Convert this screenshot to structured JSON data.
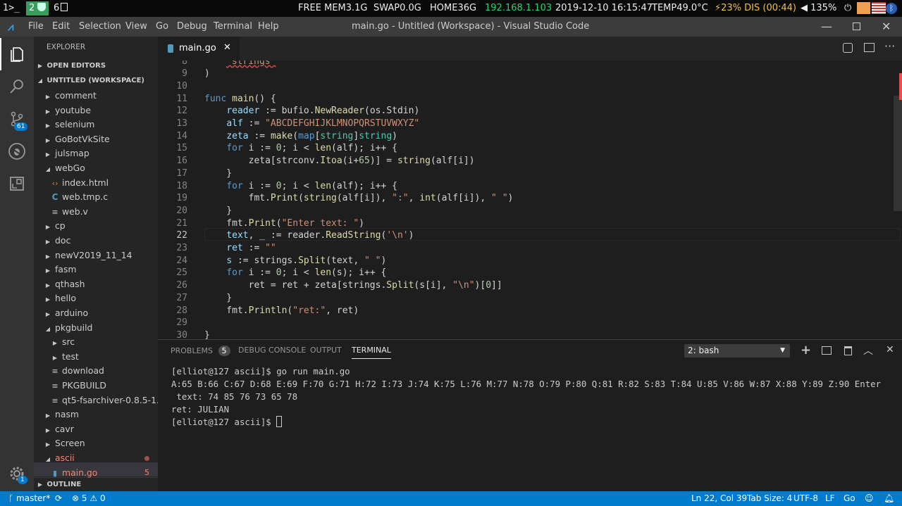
{
  "topbar": {
    "ws1": "1",
    "ws2": "2",
    "ws3": "6",
    "free_mem": "FREE MEM3.1G",
    "swap": "SWAP0.0G",
    "home": "HOME36G",
    "ip": "192.168.1.103",
    "datetime": "2019-12-10 16:15:47",
    "temp": "TEMP49.0°C",
    "battery": "⚡23% DIS (00:44)",
    "volume": "135%"
  },
  "titlebar": {
    "menus": [
      "File",
      "Edit",
      "Selection",
      "View",
      "Go",
      "Debug",
      "Terminal",
      "Help"
    ],
    "title": "main.go - Untitled (Workspace) - Visual Studio Code"
  },
  "activity": {
    "badge": "61",
    "settings_badge": "1"
  },
  "sidebar": {
    "header": "EXPLORER",
    "open_editors": "OPEN EDITORS",
    "workspace": "UNTITLED (WORKSPACE)",
    "items": [
      {
        "label": "comment",
        "indent": 1,
        "kind": "folder"
      },
      {
        "label": "youtube",
        "indent": 1,
        "kind": "folder"
      },
      {
        "label": "selenium",
        "indent": 1,
        "kind": "folder"
      },
      {
        "label": "GoBotVkSite",
        "indent": 1,
        "kind": "folder"
      },
      {
        "label": "julsmap",
        "indent": 1,
        "kind": "folder"
      },
      {
        "label": "webGo",
        "indent": 1,
        "kind": "folder-open"
      },
      {
        "label": "index.html",
        "indent": 2,
        "kind": "html"
      },
      {
        "label": "web.tmp.c",
        "indent": 2,
        "kind": "c"
      },
      {
        "label": "web.v",
        "indent": 2,
        "kind": "file"
      },
      {
        "label": "cp",
        "indent": 1,
        "kind": "folder"
      },
      {
        "label": "doc",
        "indent": 1,
        "kind": "folder"
      },
      {
        "label": "newV2019_11_14",
        "indent": 1,
        "kind": "folder"
      },
      {
        "label": "fasm",
        "indent": 1,
        "kind": "folder"
      },
      {
        "label": "qthash",
        "indent": 1,
        "kind": "folder"
      },
      {
        "label": "hello",
        "indent": 1,
        "kind": "folder"
      },
      {
        "label": "arduino",
        "indent": 1,
        "kind": "folder"
      },
      {
        "label": "pkgbuild",
        "indent": 1,
        "kind": "folder-open"
      },
      {
        "label": "src",
        "indent": 2,
        "kind": "folder"
      },
      {
        "label": "test",
        "indent": 2,
        "kind": "folder"
      },
      {
        "label": "download",
        "indent": 2,
        "kind": "file"
      },
      {
        "label": "PKGBUILD",
        "indent": 2,
        "kind": "file"
      },
      {
        "label": "qt5-fsarchiver-0.8.5-1....",
        "indent": 2,
        "kind": "file"
      },
      {
        "label": "nasm",
        "indent": 1,
        "kind": "folder"
      },
      {
        "label": "cavr",
        "indent": 1,
        "kind": "folder"
      },
      {
        "label": "Screen",
        "indent": 1,
        "kind": "folder"
      },
      {
        "label": "ascii",
        "indent": 1,
        "kind": "folder-open-err"
      },
      {
        "label": "main.go",
        "indent": 2,
        "kind": "go",
        "badge": "5"
      }
    ],
    "outline": "OUTLINE"
  },
  "editor": {
    "tab_label": "main.go",
    "lines": [
      {
        "n": "8",
        "c": [
          [
            "s",
            "\"strings\""
          ]
        ]
      },
      {
        "n": "9",
        "c": [
          [
            "p",
            ")"
          ]
        ]
      },
      {
        "n": "10",
        "c": []
      },
      {
        "n": "11",
        "c": [
          [
            "k",
            "func"
          ],
          [
            "p",
            " "
          ],
          [
            "f",
            "main"
          ],
          [
            "p",
            "() {"
          ]
        ]
      },
      {
        "n": "12",
        "c": [
          [
            "p",
            "    "
          ],
          [
            "v",
            "reader"
          ],
          [
            "p",
            " := bufio."
          ],
          [
            "f",
            "NewReader"
          ],
          [
            "p",
            "(os.Stdin)"
          ]
        ]
      },
      {
        "n": "13",
        "c": [
          [
            "p",
            "    "
          ],
          [
            "v",
            "alf"
          ],
          [
            "p",
            " := "
          ],
          [
            "s",
            "\"ABCDEFGHIJKLMNOPQRSTUVWXYZ\""
          ]
        ]
      },
      {
        "n": "14",
        "c": [
          [
            "p",
            "    "
          ],
          [
            "v",
            "zeta"
          ],
          [
            "p",
            " := "
          ],
          [
            "f",
            "make"
          ],
          [
            "p",
            "("
          ],
          [
            "k",
            "map"
          ],
          [
            "p",
            "["
          ],
          [
            "t",
            "string"
          ],
          [
            "p",
            "]"
          ],
          [
            "t",
            "string"
          ],
          [
            "p",
            ")"
          ]
        ]
      },
      {
        "n": "15",
        "c": [
          [
            "p",
            "    "
          ],
          [
            "k",
            "for"
          ],
          [
            "p",
            " i := "
          ],
          [
            "n",
            "0"
          ],
          [
            "p",
            "; i < "
          ],
          [
            "f",
            "len"
          ],
          [
            "p",
            "(alf); i++ {"
          ]
        ]
      },
      {
        "n": "16",
        "c": [
          [
            "p",
            "        zeta[strconv."
          ],
          [
            "f",
            "Itoa"
          ],
          [
            "p",
            "(i+"
          ],
          [
            "n",
            "65"
          ],
          [
            "p",
            ")] = "
          ],
          [
            "f",
            "string"
          ],
          [
            "p",
            "(alf[i])"
          ]
        ]
      },
      {
        "n": "17",
        "c": [
          [
            "p",
            "    }"
          ]
        ]
      },
      {
        "n": "18",
        "c": [
          [
            "p",
            "    "
          ],
          [
            "k",
            "for"
          ],
          [
            "p",
            " i := "
          ],
          [
            "n",
            "0"
          ],
          [
            "p",
            "; i < "
          ],
          [
            "f",
            "len"
          ],
          [
            "p",
            "(alf); i++ {"
          ]
        ]
      },
      {
        "n": "19",
        "c": [
          [
            "p",
            "        fmt."
          ],
          [
            "f",
            "Print"
          ],
          [
            "p",
            "("
          ],
          [
            "f",
            "string"
          ],
          [
            "p",
            "(alf[i]), "
          ],
          [
            "s",
            "\":\""
          ],
          [
            "p",
            ", "
          ],
          [
            "f",
            "int"
          ],
          [
            "p",
            "(alf[i]), "
          ],
          [
            "s",
            "\" \""
          ],
          [
            "p",
            ")"
          ]
        ]
      },
      {
        "n": "20",
        "c": [
          [
            "p",
            "    }"
          ]
        ]
      },
      {
        "n": "21",
        "c": [
          [
            "p",
            "    fmt."
          ],
          [
            "f",
            "Print"
          ],
          [
            "p",
            "("
          ],
          [
            "s",
            "\"Enter text: \""
          ],
          [
            "p",
            ")"
          ]
        ]
      },
      {
        "n": "22",
        "c": [
          [
            "p",
            "    "
          ],
          [
            "v",
            "text"
          ],
          [
            "p",
            ", _ := reader."
          ],
          [
            "f",
            "ReadString"
          ],
          [
            "p",
            "("
          ],
          [
            "s",
            "'\\n'"
          ],
          [
            "p",
            ")"
          ]
        ]
      },
      {
        "n": "23",
        "c": [
          [
            "p",
            "    "
          ],
          [
            "v",
            "ret"
          ],
          [
            "p",
            " := "
          ],
          [
            "s",
            "\"\""
          ]
        ]
      },
      {
        "n": "24",
        "c": [
          [
            "p",
            "    "
          ],
          [
            "v",
            "s"
          ],
          [
            "p",
            " := strings."
          ],
          [
            "f",
            "Split"
          ],
          [
            "p",
            "(text, "
          ],
          [
            "s",
            "\" \""
          ],
          [
            "p",
            ")"
          ]
        ]
      },
      {
        "n": "25",
        "c": [
          [
            "p",
            "    "
          ],
          [
            "k",
            "for"
          ],
          [
            "p",
            " i := "
          ],
          [
            "n",
            "0"
          ],
          [
            "p",
            "; i < "
          ],
          [
            "f",
            "len"
          ],
          [
            "p",
            "(s); i++ {"
          ]
        ]
      },
      {
        "n": "26",
        "c": [
          [
            "p",
            "        ret = ret + zeta[strings."
          ],
          [
            "f",
            "Split"
          ],
          [
            "p",
            "(s[i], "
          ],
          [
            "s",
            "\"\\n\""
          ],
          [
            "p",
            ")["
          ],
          [
            "n",
            "0"
          ],
          [
            "p",
            "]]"
          ]
        ]
      },
      {
        "n": "27",
        "c": [
          [
            "p",
            "    }"
          ]
        ]
      },
      {
        "n": "28",
        "c": [
          [
            "p",
            "    fmt."
          ],
          [
            "f",
            "Println"
          ],
          [
            "p",
            "("
          ],
          [
            "s",
            "\"ret:\""
          ],
          [
            "p",
            ", ret)"
          ]
        ]
      },
      {
        "n": "29",
        "c": []
      },
      {
        "n": "30",
        "c": [
          [
            "p",
            "}"
          ]
        ]
      }
    ]
  },
  "panel": {
    "tabs": {
      "problems": "PROBLEMS",
      "problems_count": "5",
      "debug": "DEBUG CONSOLE",
      "output": "OUTPUT",
      "terminal": "TERMINAL"
    },
    "shell_select": "2: bash",
    "terminal_lines": [
      "[elliot@127 ascii]$ go run main.go",
      "A:65 B:66 C:67 D:68 E:69 F:70 G:71 H:72 I:73 J:74 K:75 L:76 M:77 N:78 O:79 P:80 Q:81 R:82 S:83 T:84 U:85 V:86 W:87 X:88 Y:89 Z:90 Enter",
      " text: 74 85 76 73 65 78",
      "ret: JULIAN",
      "[elliot@127 ascii]$ "
    ]
  },
  "status": {
    "branch": "master*",
    "errors": "5",
    "warnings": "0",
    "position": "Ln 22, Col 39",
    "tab_size": "Tab Size: 4",
    "encoding": "UTF-8",
    "eol": "LF",
    "language": "Go"
  }
}
